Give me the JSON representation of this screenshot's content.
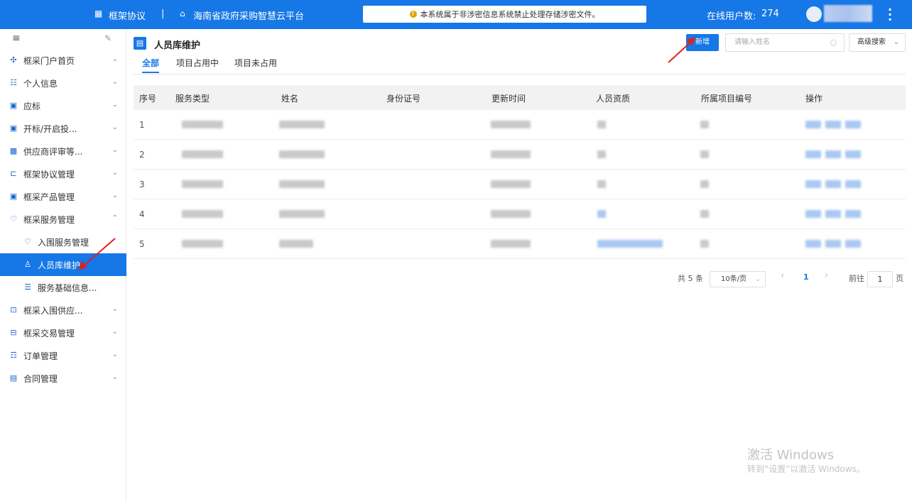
{
  "topbar": {
    "app_title": "框架协议",
    "separator": "|",
    "platform": "海南省政府采购智慧云平台",
    "notice": "本系统属于非涉密信息系统禁止处理存储涉密文件。",
    "notice_icon": "warning-icon",
    "online_users_label": "在线用户数:",
    "online_users_count": "274",
    "menu_icon": "more-vertical-icon",
    "colors": {
      "bar": "#1677e6",
      "notice_dot": "#d9a100"
    }
  },
  "sidebar": {
    "collapse_icon": "hamburger-icon",
    "pin_icon": "pin-icon",
    "items": [
      {
        "label": "框采门户首页",
        "icon": "apps-icon",
        "chevron": "⌄"
      },
      {
        "label": "个人信息",
        "icon": "profile-icon",
        "chevron": "⌄"
      },
      {
        "label": "应标",
        "icon": "bid-icon",
        "chevron": "⌄"
      },
      {
        "label": "开标/开启投...",
        "icon": "open-bid-icon",
        "chevron": "⌄"
      },
      {
        "label": "供应商评审等...",
        "icon": "review-icon",
        "chevron": "⌄"
      },
      {
        "label": "框架协议管理",
        "icon": "agreement-icon",
        "chevron": "⌄"
      },
      {
        "label": "框采产品管理",
        "icon": "product-icon",
        "chevron": "⌄"
      },
      {
        "label": "框采服务管理",
        "icon": "service-icon",
        "chevron": "⌃"
      },
      {
        "label": "入围服务管理",
        "icon": "shortlist-service-icon",
        "chevron": ""
      },
      {
        "label": "人员库维护",
        "icon": "person-icon",
        "chevron": ""
      },
      {
        "label": "服务基础信息...",
        "icon": "service-info-icon",
        "chevron": ""
      },
      {
        "label": "框采入围供应...",
        "icon": "supplier-icon",
        "chevron": "⌄"
      },
      {
        "label": "框采交易管理",
        "icon": "trade-icon",
        "chevron": "⌄"
      },
      {
        "label": "订单管理",
        "icon": "order-icon",
        "chevron": "⌄"
      },
      {
        "label": "合同管理",
        "icon": "contract-icon",
        "chevron": "⌄"
      }
    ]
  },
  "main": {
    "title": "人员库维护",
    "add_button": "新增",
    "search_placeholder": "请输入姓名",
    "advanced_search": "高级搜索",
    "tabs": [
      "全部",
      "项目占用中",
      "项目未占用"
    ],
    "table": {
      "headers": [
        "序号",
        "服务类型",
        "姓名",
        "身份证号",
        "更新时间",
        "人员资质",
        "所属项目编号",
        "操作"
      ],
      "rows": [
        {
          "index": "1"
        },
        {
          "index": "2"
        },
        {
          "index": "3"
        },
        {
          "index": "4"
        },
        {
          "index": "5"
        }
      ]
    },
    "pagination": {
      "total": "共 5 条",
      "page_size": "10条/页",
      "prev": "‹",
      "current": "1",
      "next": "›",
      "goto_label": "前往",
      "goto_value": "1",
      "goto_suffix": "页"
    }
  },
  "watermark": {
    "line1": "激活 Windows",
    "line2": "转到“设置”以激活 Windows。"
  }
}
